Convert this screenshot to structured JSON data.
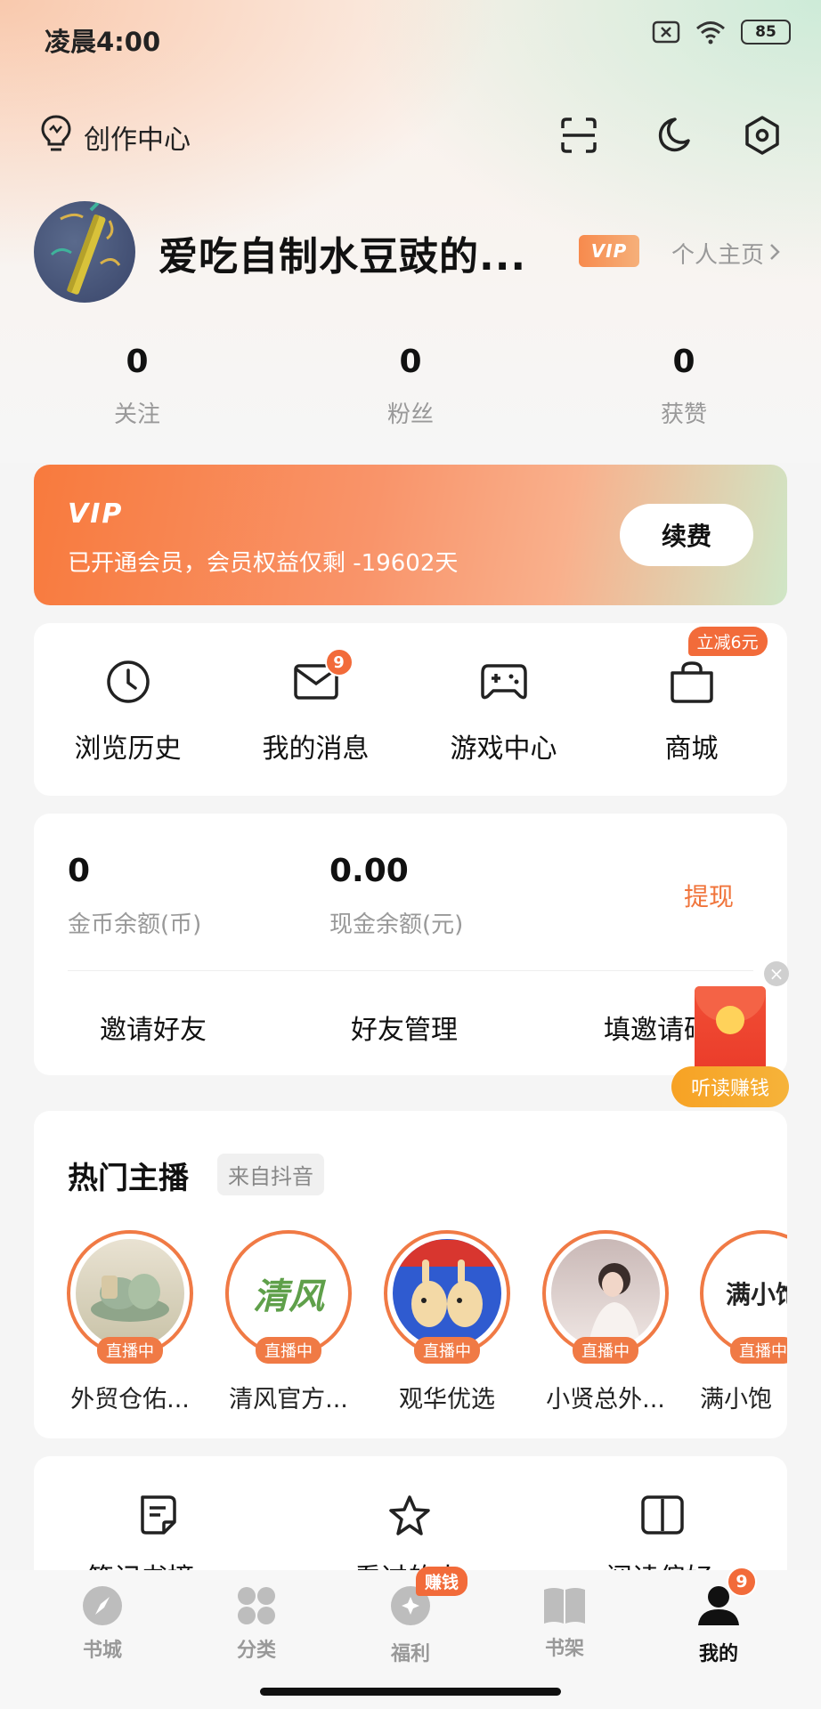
{
  "status_bar": {
    "time": "凌晨4:00",
    "battery": "85",
    "icons": [
      "sim-x-icon",
      "wifi-icon",
      "battery-icon"
    ]
  },
  "header": {
    "creator_center": "创作中心",
    "icons": [
      "scan-icon",
      "moon-icon",
      "settings-icon"
    ]
  },
  "profile": {
    "username": "爱吃自制水豆豉的...",
    "vip_badge": "VIP",
    "profile_link": "个人主页"
  },
  "stats": [
    {
      "value": "0",
      "label": "关注"
    },
    {
      "value": "0",
      "label": "粉丝"
    },
    {
      "value": "0",
      "label": "获赞"
    }
  ],
  "vip_card": {
    "logo": "VIP",
    "description": "已开通会员，会员权益仅剩 -19602天",
    "renew_label": "续费"
  },
  "quick_actions": [
    {
      "label": "浏览历史",
      "icon": "clock-icon"
    },
    {
      "label": "我的消息",
      "icon": "mail-icon",
      "badge": "9"
    },
    {
      "label": "游戏中心",
      "icon": "gamepad-icon"
    },
    {
      "label": "商城",
      "icon": "shopping-bag-icon",
      "tag": "立减6元"
    }
  ],
  "wallet": {
    "coins_value": "0",
    "coins_label": "金币余额(币)",
    "cash_value": "0.00",
    "cash_label": "现金余额(元)",
    "withdraw_label": "提现",
    "links": [
      "邀请好友",
      "好友管理",
      "填邀请码"
    ]
  },
  "float_widget": {
    "label": "听读赚钱",
    "close": "×"
  },
  "hot_anchors": {
    "title": "热门主播",
    "source": "来自抖音",
    "live_label": "直播中",
    "items": [
      {
        "name": "外贸仓佑..."
      },
      {
        "name": "清风官方..."
      },
      {
        "name": "观华优选"
      },
      {
        "name": "小贤总外..."
      },
      {
        "name": "满小饱"
      }
    ],
    "logo_text_qingfeng": "清风",
    "logo_text_manxiao": "满小饱"
  },
  "bottom_section": {
    "items": [
      {
        "label": "笔记书摘",
        "icon": "note-icon"
      },
      {
        "label": "看过的人",
        "icon": "star-icon"
      },
      {
        "label": "阅读偏好",
        "icon": "book-open-icon"
      }
    ]
  },
  "tabbar": {
    "tabs": [
      {
        "label": "书城",
        "icon": "compass-icon"
      },
      {
        "label": "分类",
        "icon": "grid-icon"
      },
      {
        "label": "福利",
        "icon": "gift-coin-icon",
        "tag": "赚钱"
      },
      {
        "label": "书架",
        "icon": "bookshelf-icon"
      },
      {
        "label": "我的",
        "icon": "person-icon",
        "badge": "9",
        "active": true
      }
    ]
  },
  "colors": {
    "accent": "#F26B3A",
    "live_ring": "#F07A45",
    "gold": "#F6A928"
  }
}
